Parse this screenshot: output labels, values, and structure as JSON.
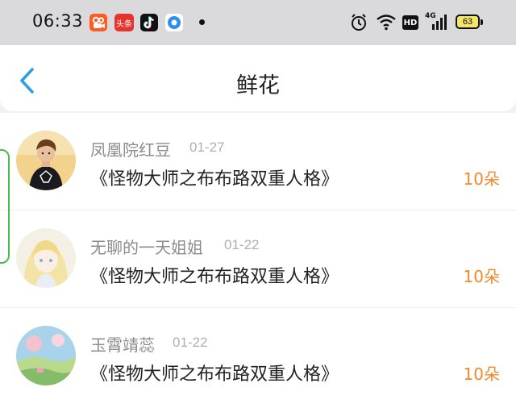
{
  "status_bar": {
    "time": "06:33",
    "battery": "63",
    "network": "4G",
    "hd_label": "HD",
    "app_icons": [
      "kuaishou-icon",
      "toutiao-icon",
      "douyin-icon",
      "browser-icon"
    ],
    "toutiao_label": "头条"
  },
  "header": {
    "title": "鲜花",
    "back_icon": "chevron-left-icon"
  },
  "colors": {
    "accent_blue": "#2f9de6",
    "count_orange": "#f0892b",
    "edge_green": "#4cbb4c"
  },
  "entries": [
    {
      "name": "凤凰院红豆",
      "date": "01-27",
      "book": "《怪物大师之布布路双重人格》",
      "count": "10朵"
    },
    {
      "name": "无聊的一天姐姐",
      "date": "01-22",
      "book": "《怪物大师之布布路双重人格》",
      "count": "10朵"
    },
    {
      "name": "玉霄靖蕊",
      "date": "01-22",
      "book": "《怪物大师之布布路双重人格》",
      "count": "10朵"
    }
  ]
}
